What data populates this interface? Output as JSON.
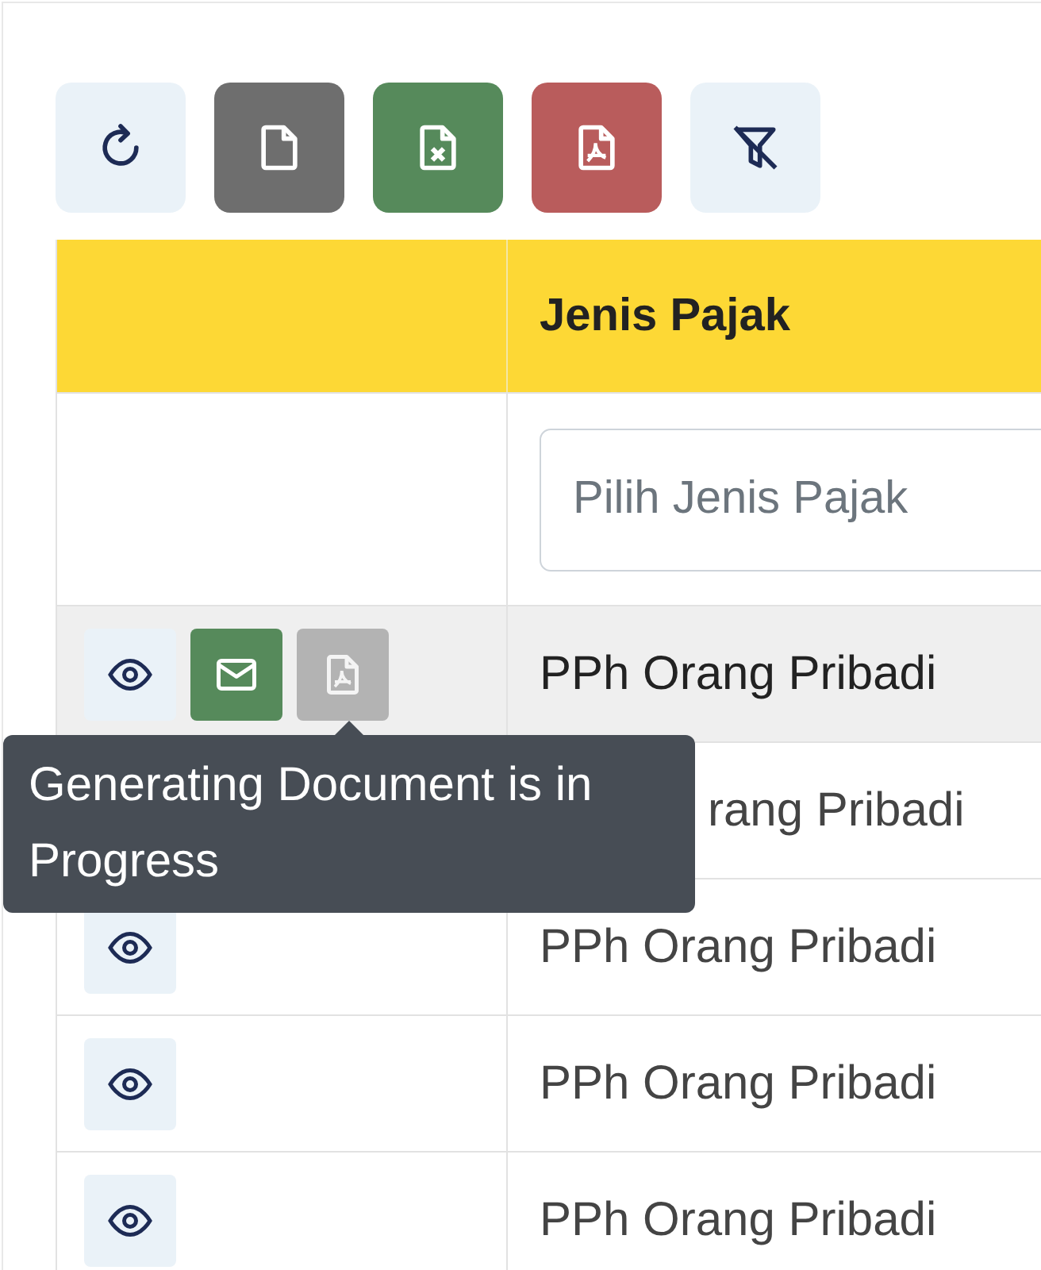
{
  "toolbar": [
    {
      "kind": "refresh"
    },
    {
      "kind": "blank"
    },
    {
      "kind": "excel"
    },
    {
      "kind": "pdf"
    },
    {
      "kind": "clear-filter"
    }
  ],
  "table": {
    "columns": [
      {
        "label": "Jenis Pajak"
      }
    ],
    "filter": {
      "placeholder": "Pilih Jenis Pajak"
    },
    "rows": [
      {
        "hovered": true,
        "actions": [
          {
            "kind": "view",
            "disabled": false
          },
          {
            "kind": "email",
            "disabled": false
          },
          {
            "kind": "pdf",
            "disabled": true
          }
        ],
        "jenis_pajak": "PPh Orang Pribadi"
      },
      {
        "hovered": false,
        "covered": true,
        "actions": [],
        "jenis_pajak": "rang Pribadi"
      },
      {
        "hovered": false,
        "actions": [
          {
            "kind": "view",
            "disabled": false
          }
        ],
        "jenis_pajak": "PPh Orang Pribadi"
      },
      {
        "hovered": false,
        "actions": [
          {
            "kind": "view",
            "disabled": false
          }
        ],
        "jenis_pajak": "PPh Orang Pribadi"
      },
      {
        "hovered": false,
        "actions": [
          {
            "kind": "view",
            "disabled": false
          }
        ],
        "jenis_pajak": "PPh Orang Pribadi"
      }
    ]
  },
  "tooltip": {
    "text": "Generating Document is in Progress"
  }
}
